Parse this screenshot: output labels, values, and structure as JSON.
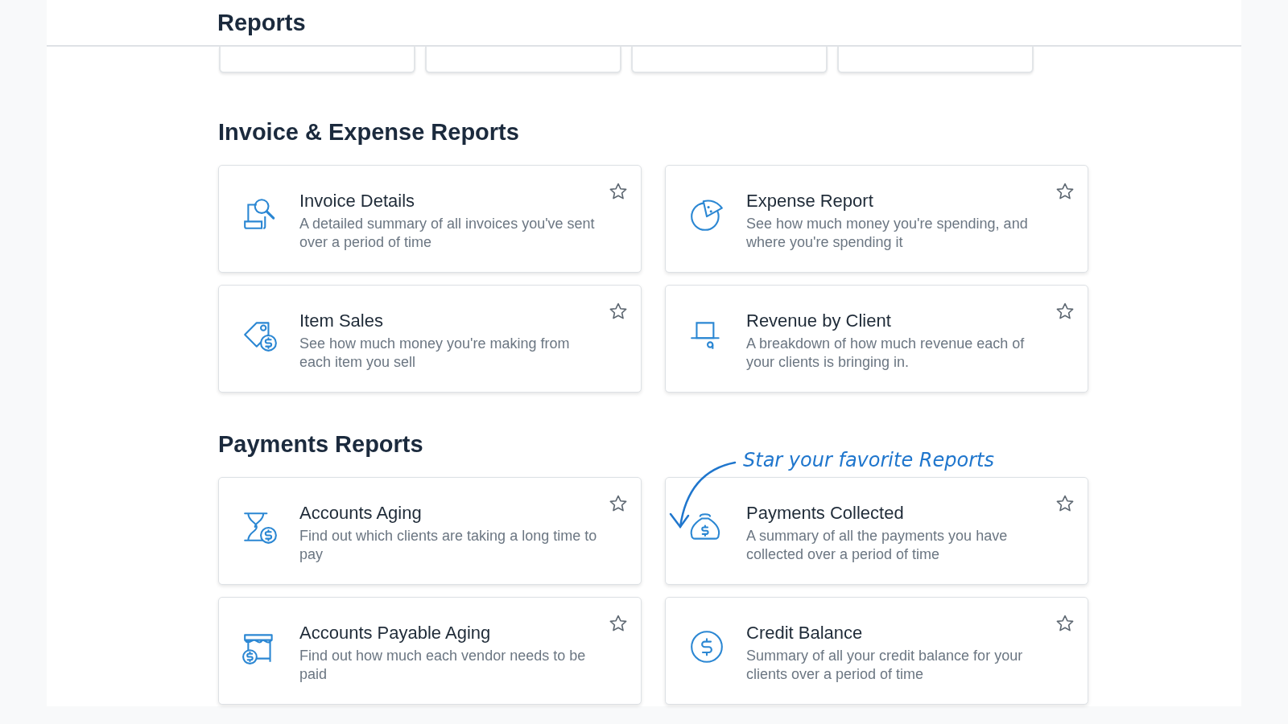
{
  "header": {
    "title": "Reports"
  },
  "sections": [
    {
      "title": "Invoice & Expense Reports",
      "cards": [
        {
          "title": "Invoice Details",
          "description": "A detailed summary of all invoices you've sent over a period of time",
          "starred": false
        },
        {
          "title": "Expense Report",
          "description": "See how much money you're spending, and where you're spending it",
          "starred": false
        },
        {
          "title": "Item Sales",
          "description": "See how much money you're making from each item you sell",
          "starred": false
        },
        {
          "title": "Revenue by Client",
          "description": "A breakdown of how much revenue each of your clients is bringing in.",
          "starred": false
        }
      ]
    },
    {
      "title": "Payments Reports",
      "annotation": "Star your favorite Reports",
      "cards": [
        {
          "title": "Accounts Aging",
          "description": "Find out which clients are taking a long time to pay",
          "starred": false
        },
        {
          "title": "Payments Collected",
          "description": "A summary of all the payments you have collected over a period of time",
          "starred": false
        },
        {
          "title": "Accounts Payable Aging",
          "description": "Find out how much each vendor needs to be paid",
          "starred": false
        },
        {
          "title": "Credit Balance",
          "description": "Summary of all your credit balance for your clients over a period of time",
          "starred": false
        }
      ]
    }
  ]
}
